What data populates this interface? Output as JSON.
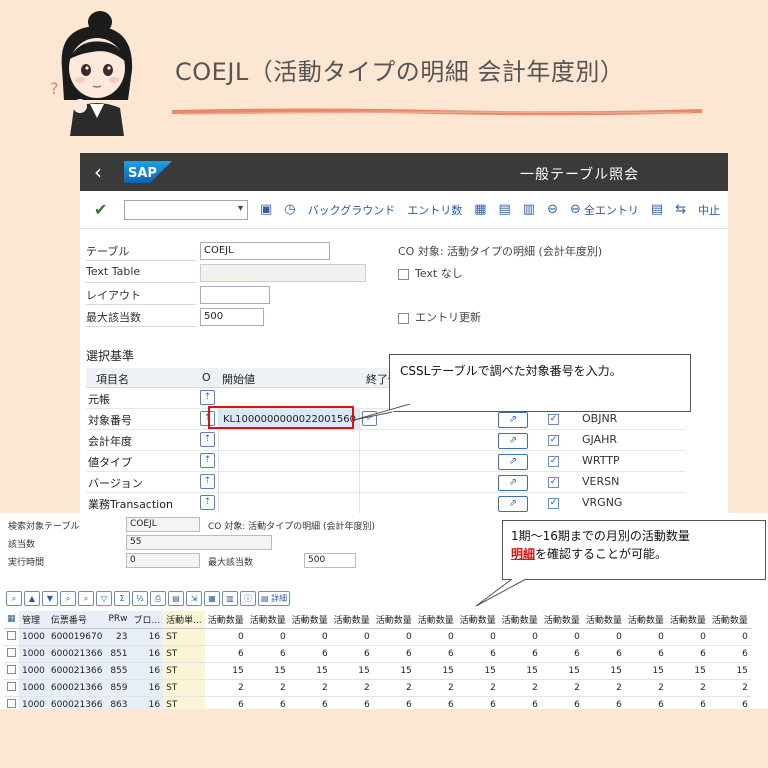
{
  "page": {
    "title": "COEJL（活動タイプの明細 会計年度別）"
  },
  "sap": {
    "shell_title": "一般テーブル照会",
    "logo": "SAP",
    "toolbar": {
      "items": [
        "バックグラウンド",
        "エントリ数",
        "全エントリ",
        "中止"
      ]
    },
    "form": {
      "table_label": "テーブル",
      "table_value": "COEJL",
      "table_desc": "CO 対象: 活動タイプの明細 (会計年度別)",
      "texttable_label": "Text Table",
      "textnone_label": "Text なし",
      "layout_label": "レイアウト",
      "maxhits_label": "最大該当数",
      "maxhits_value": "500",
      "entryupdate_label": "エントリ更新"
    },
    "selection": {
      "heading": "選択基準",
      "col_name": "項目名",
      "col_o": "O",
      "col_from": "開始値",
      "col_to": "終了値",
      "rows": [
        {
          "name": "元帳",
          "value": "",
          "field": ""
        },
        {
          "name": "対象番号",
          "value": "KL1000000000022001560",
          "field": "OBJNR"
        },
        {
          "name": "会計年度",
          "value": "",
          "field": "GJAHR"
        },
        {
          "name": "値タイプ",
          "value": "",
          "field": "WRTTP"
        },
        {
          "name": "バージョン",
          "value": "",
          "field": "VERSN"
        },
        {
          "name": "業務Transaction",
          "value": "",
          "field": "VRGNG"
        }
      ]
    }
  },
  "callouts": {
    "top": "CSSLテーブルで調べた対象番号を入力。",
    "bottom_line1": "1期～16期までの月別の活動数量",
    "bottom_em": "明細",
    "bottom_rest": "を確認することが可能。"
  },
  "results": {
    "search_table_label": "検索対象テーブル",
    "search_table_value": "COEJL",
    "search_table_desc": "CO 対象: 活動タイプの明細 (会計年度別)",
    "hits_label": "該当数",
    "hits_value": "55",
    "runtime_label": "実行時間",
    "runtime_value": "0",
    "maxhits_label": "最大該当数",
    "maxhits_value": "500",
    "detail_button": "詳細",
    "columns": [
      "管理",
      "伝票番号",
      "PRw",
      "ブロ...",
      "活動単...",
      "活動数量",
      "活動数量",
      "活動数量",
      "活動数量",
      "活動数量",
      "活動数量",
      "活動数量",
      "活動数量",
      "活動数量",
      "活動数量",
      "活動数量",
      "活動数量",
      "活動数量"
    ],
    "rows": [
      [
        "1000",
        "600019670",
        "23",
        "16",
        "ST",
        "0",
        "0",
        "0",
        "0",
        "0",
        "0",
        "0",
        "0",
        "0",
        "0",
        "0",
        "0",
        "0"
      ],
      [
        "1000",
        "600021366",
        "851",
        "16",
        "ST",
        "6",
        "6",
        "6",
        "6",
        "6",
        "6",
        "6",
        "6",
        "6",
        "6",
        "6",
        "6",
        "6"
      ],
      [
        "1000",
        "600021366",
        "855",
        "16",
        "ST",
        "15",
        "15",
        "15",
        "15",
        "15",
        "15",
        "15",
        "15",
        "15",
        "15",
        "15",
        "15",
        "15"
      ],
      [
        "1000",
        "600021366",
        "859",
        "16",
        "ST",
        "2",
        "2",
        "2",
        "2",
        "2",
        "2",
        "2",
        "2",
        "2",
        "2",
        "2",
        "2",
        "2"
      ],
      [
        "1000",
        "600021366",
        "863",
        "16",
        "ST",
        "6",
        "6",
        "6",
        "6",
        "6",
        "6",
        "6",
        "6",
        "6",
        "6",
        "6",
        "6",
        "6"
      ]
    ]
  }
}
